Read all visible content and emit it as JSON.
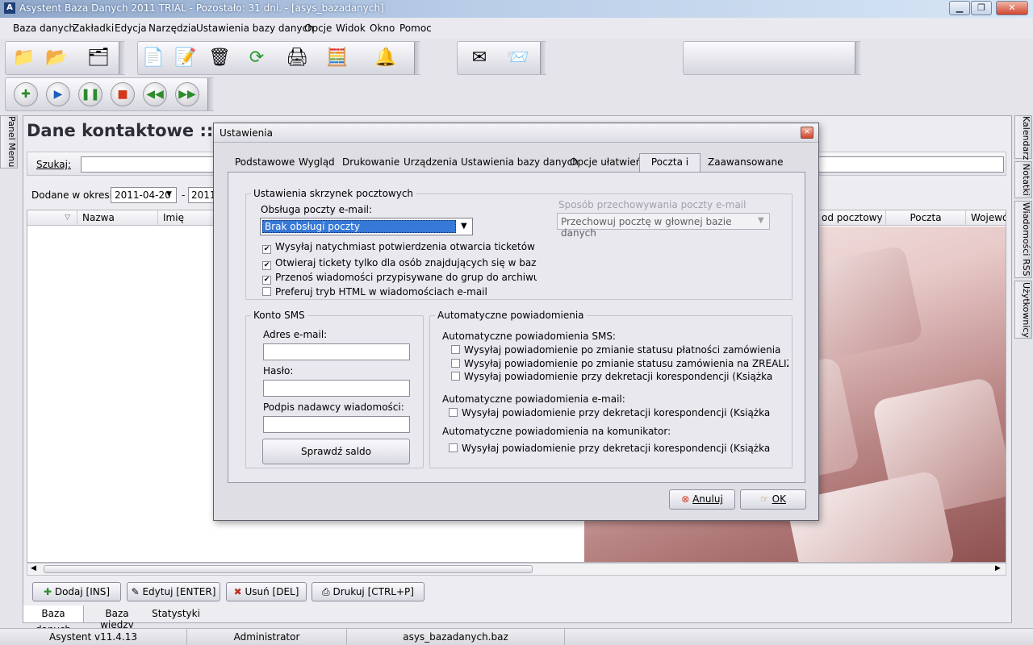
{
  "window": {
    "title": "Asystent Baza Danych 2011 TRIAL - Pozostało: 31 dni. - [asys_bazadanych]"
  },
  "menu": [
    "Baza danych",
    "Zakładki",
    "Edycja",
    "Narzędzia",
    "Ustawienia bazy danych",
    "Opcje",
    "Widok",
    "Okno",
    "Pomoc"
  ],
  "side_tabs": {
    "left": "Panel Menu",
    "right": [
      "Kalendarz",
      "Notatki",
      "Wiadomości RSS",
      "Użytkownicy"
    ]
  },
  "main": {
    "heading": "Dane kontaktowe :: W",
    "search_label": "Szukaj:",
    "search_value": "",
    "period_label": "Dodane w okresie:",
    "date_from": "2011-04-20",
    "date_to": "2011-",
    "date_sep": "-",
    "grid_headers": {
      "nazwa": "Nazwa",
      "imie": "Imię",
      "kod": "od pocztowy",
      "poczta": "Poczta",
      "woj": "Wojewód"
    },
    "buttons": {
      "add": "Dodaj [INS]",
      "edit": "Edytuj [ENTER]",
      "delete": "Usuń [DEL]",
      "print": "Drukuj [CTRL+P]"
    },
    "bottom_tabs": [
      "Baza danych",
      "Baza wiedzy",
      "Statystyki"
    ]
  },
  "statusbar": {
    "version": "Asystent v11.4.13",
    "user": "Administrator",
    "file": "asys_bazadanych.baz"
  },
  "dialog": {
    "title": "Ustawienia",
    "tabs": [
      "Podstawowe",
      "Wygląd",
      "Drukowanie",
      "Urządzenia",
      "Ustawienia bazy danych",
      "Opcje ułatwień",
      "Poczta i SMS",
      "Zaawansowane"
    ],
    "active_tab": "Poczta i SMS",
    "mail_boxes": {
      "legend": "Ustawienia skrzynek pocztowych",
      "handling_label": "Obsługa poczty e-mail:",
      "handling_value": "Brak obsługi poczty",
      "storage_label": "Sposób przechowywania poczty e-mail",
      "storage_value": "Przechowuj pocztę w głownej bazie danych",
      "options": [
        {
          "label": "Wysyłaj natychmiast potwierdzenia otwarcia ticketów",
          "checked": true
        },
        {
          "label": "Otwieraj tickety tylko dla osób znajdujących się w bazie",
          "checked": true
        },
        {
          "label": "Przenoś wiadomości przypisywane do grup do archiwum",
          "checked": true
        },
        {
          "label": "Preferuj tryb HTML w wiadomościach e-mail",
          "checked": false
        }
      ]
    },
    "sms": {
      "legend": "Konto SMS",
      "email_label": "Adres e-mail:",
      "email_value": "",
      "password_label": "Hasło:",
      "password_value": "",
      "signature_label": "Podpis nadawcy wiadomości:",
      "signature_value": "",
      "balance_button": "Sprawdź saldo"
    },
    "notifications": {
      "legend": "Automatyczne powiadomienia",
      "sms_heading": "Automatyczne powiadomienia SMS:",
      "sms_options": [
        {
          "label": "Wysyłaj powiadomienie po zmianie statusu płatności zamówienia",
          "checked": false
        },
        {
          "label": "Wysyłaj powiadomienie po zmianie statusu zamówienia na ZREALIZOWANE",
          "checked": false
        },
        {
          "label": "Wysyłaj powiadomienie przy dekretacji korespondencji (Książka",
          "checked": false
        }
      ],
      "email_heading": "Automatyczne powiadomienia e-mail:",
      "email_options": [
        {
          "label": "Wysyłaj powiadomienie przy dekretacji korespondencji (Książka",
          "checked": false
        }
      ],
      "im_heading": "Automatyczne powiadomienia na komunikator:",
      "im_options": [
        {
          "label": "Wysyłaj powiadomienie przy dekretacji korespondencji (Książka",
          "checked": false
        }
      ]
    },
    "cancel_label": "Anuluj",
    "ok_label": "OK"
  }
}
